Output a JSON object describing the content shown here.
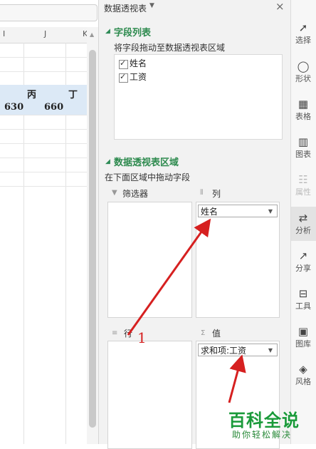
{
  "sheet": {
    "columns": [
      "I",
      "J",
      "K"
    ],
    "header_cells": [
      "丙",
      "丁"
    ],
    "value_cells": [
      "630",
      "660"
    ]
  },
  "pane": {
    "title": "数据透视表",
    "fields_section_title": "字段列表",
    "fields_hint": "将字段拖动至数据透视表区域",
    "fields": [
      {
        "label": "姓名",
        "checked": true
      },
      {
        "label": "工资",
        "checked": true
      }
    ],
    "areas_section_title": "数据透视表区域",
    "areas_hint": "在下面区域中拖动字段",
    "filter_label": "筛选器",
    "column_label": "列",
    "row_label": "行",
    "value_label": "值",
    "column_item": "姓名",
    "value_item": "求和项:工资"
  },
  "toolbar": {
    "items": [
      {
        "label": "选择",
        "icon": "cursor-icon"
      },
      {
        "label": "形状",
        "icon": "shape-icon"
      },
      {
        "label": "表格",
        "icon": "table-icon"
      },
      {
        "label": "图表",
        "icon": "chart-icon"
      },
      {
        "label": "属性",
        "icon": "properties-icon"
      },
      {
        "label": "分析",
        "icon": "analysis-icon"
      },
      {
        "label": "分享",
        "icon": "share-icon"
      },
      {
        "label": "工具",
        "icon": "toolbox-icon"
      },
      {
        "label": "图库",
        "icon": "gallery-icon"
      },
      {
        "label": "风格",
        "icon": "style-icon"
      }
    ]
  },
  "annotation": {
    "number": "1",
    "color": "#d62020"
  },
  "watermark": {
    "main": "百科全说",
    "sub": "助你轻松解决"
  },
  "colors": {
    "accent_green": "#2d8a4e",
    "selection_blue": "#dce9f6",
    "arrow_red": "#d62020"
  }
}
